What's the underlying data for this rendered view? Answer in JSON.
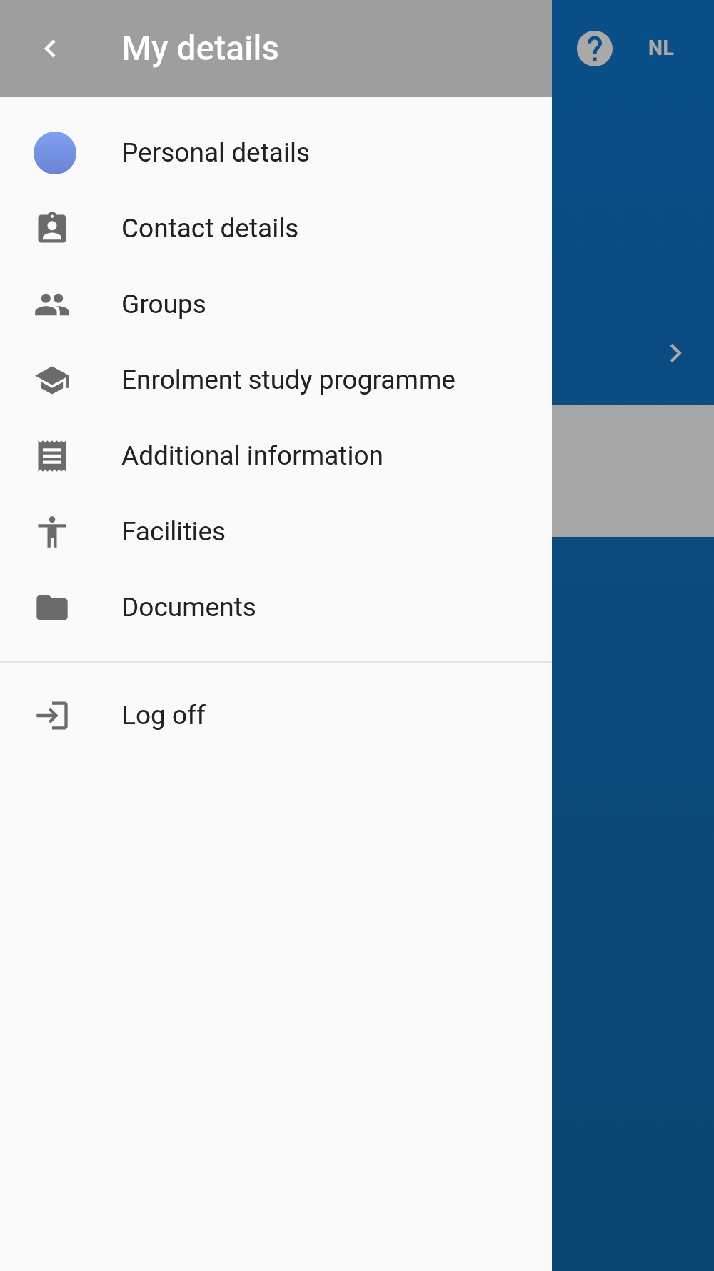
{
  "header": {
    "title": "My details"
  },
  "items": [
    {
      "kind": "avatar",
      "label": "Personal details"
    },
    {
      "kind": "contact",
      "label": "Contact details"
    },
    {
      "kind": "groups",
      "label": "Groups"
    },
    {
      "kind": "school",
      "label": "Enrolment study programme"
    },
    {
      "kind": "receipt",
      "label": "Additional information"
    },
    {
      "kind": "accessibility",
      "label": "Facilities"
    },
    {
      "kind": "folder",
      "label": "Documents"
    }
  ],
  "footer_items": [
    {
      "kind": "logout",
      "label": "Log off"
    }
  ],
  "background": {
    "language": "NL"
  }
}
